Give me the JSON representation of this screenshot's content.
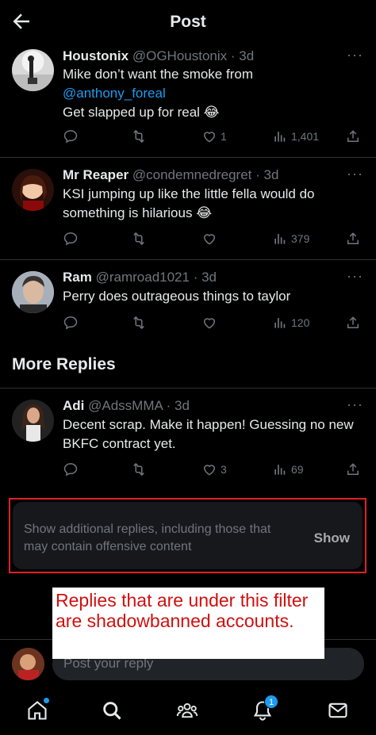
{
  "header": {
    "title": "Post",
    "back_icon": "arrow-left-icon"
  },
  "replies": [
    {
      "name": "Houstonix",
      "handle": "@OGHoustonix",
      "time": "· 3d",
      "text_line1": "Mike don’t want the smoke from",
      "mention": "@anthony_foreal",
      "text_line3": "Get slapped up for real 😂",
      "likes": "1",
      "views": "1,401"
    },
    {
      "name": "Mr Reaper",
      "handle": "@condemnedregret",
      "time": "· 3d",
      "text": "KSI jumping up like the little fella would do something is hilarious 😂",
      "likes": "",
      "views": "379"
    },
    {
      "name": "Ram",
      "handle": "@ramroad1021",
      "time": "· 3d",
      "text": "Perry does outrageous things to taylor",
      "likes": "",
      "views": "120"
    }
  ],
  "more_replies": {
    "title": "More Replies",
    "items": [
      {
        "name": "Adi",
        "handle": "@AdssMMA",
        "time": "· 3d",
        "text": "Decent scrap. Make it happen! Guessing no new BKFC contract yet.",
        "likes": "3",
        "views": "69"
      }
    ]
  },
  "hidden_replies": {
    "text": "Show additional replies, including those that may contain offensive content",
    "button": "Show"
  },
  "annotation": {
    "text": "Replies that are under this filter are shadowbanned accounts."
  },
  "compose": {
    "placeholder": "Post your reply"
  },
  "bottom_nav": {
    "items": [
      "home-icon",
      "search-icon",
      "communities-icon",
      "notifications-icon",
      "messages-icon"
    ],
    "notification_count": "1"
  },
  "colors": {
    "accent": "#1d9bf0",
    "annotation_red": "#d10f0f",
    "highlight_border": "#e0202a"
  }
}
